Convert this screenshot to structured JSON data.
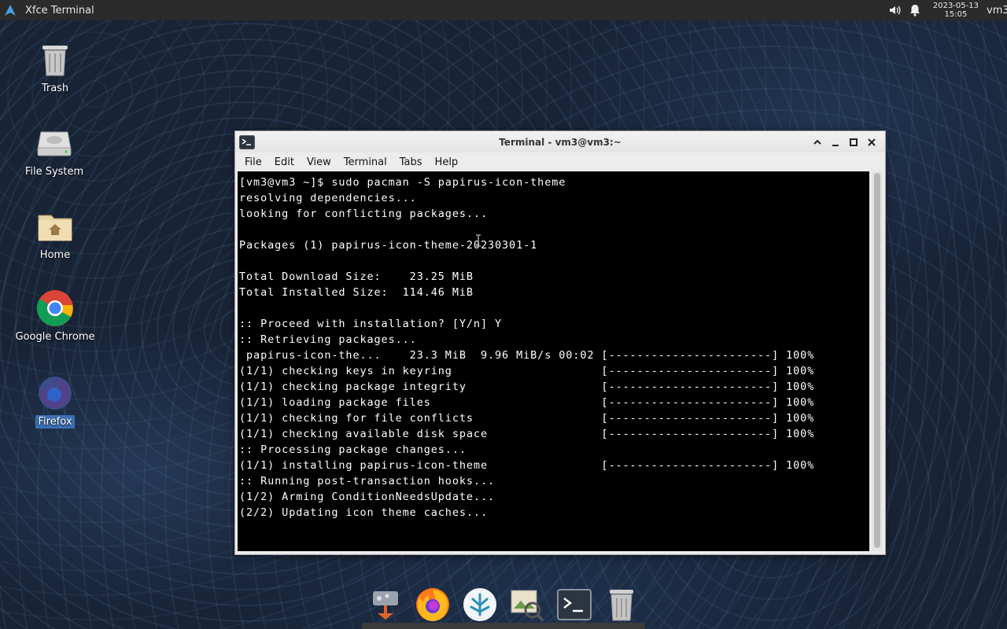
{
  "top_panel": {
    "active_window_title": "Xfce Terminal",
    "clock_date": "2023-05-13",
    "clock_time": "15:05",
    "user": "vm3",
    "tray_icons": [
      "volume-icon",
      "notification-bell-icon"
    ]
  },
  "desktop": {
    "icons": [
      {
        "label": "Trash",
        "icon": "trash-icon"
      },
      {
        "label": "File System",
        "icon": "drive-icon"
      },
      {
        "label": "Home",
        "icon": "home-folder-icon"
      },
      {
        "label": "Google Chrome",
        "icon": "chrome-icon"
      },
      {
        "label": "Firefox",
        "icon": "firefox-icon",
        "selected": true
      }
    ]
  },
  "window": {
    "title": "Terminal - vm3@vm3:~",
    "menu": [
      "File",
      "Edit",
      "View",
      "Terminal",
      "Tabs",
      "Help"
    ],
    "lines": [
      "[vm3@vm3 ~]$ sudo pacman -S papirus-icon-theme",
      "resolving dependencies...",
      "looking for conflicting packages...",
      "",
      "Packages (1) papirus-icon-theme-20230301-1",
      "",
      "Total Download Size:    23.25 MiB",
      "Total Installed Size:  114.46 MiB",
      "",
      ":: Proceed with installation? [Y/n] Y",
      ":: Retrieving packages...",
      " papirus-icon-the...    23.3 MiB  9.96 MiB/s 00:02 [-----------------------] 100%",
      "(1/1) checking keys in keyring                     [-----------------------] 100%",
      "(1/1) checking package integrity                   [-----------------------] 100%",
      "(1/1) loading package files                        [-----------------------] 100%",
      "(1/1) checking for file conflicts                  [-----------------------] 100%",
      "(1/1) checking available disk space                [-----------------------] 100%",
      ":: Processing package changes...",
      "(1/1) installing papirus-icon-theme                [-----------------------] 100%",
      ":: Running post-transaction hooks...",
      "(1/2) Arming ConditionNeedsUpdate...",
      "(2/2) Updating icon theme caches..."
    ]
  },
  "dock": {
    "items": [
      "app-finder-icon",
      "firefox-icon",
      "settings-manager-icon",
      "image-viewer-icon",
      "terminal-icon",
      "trash-icon"
    ]
  }
}
